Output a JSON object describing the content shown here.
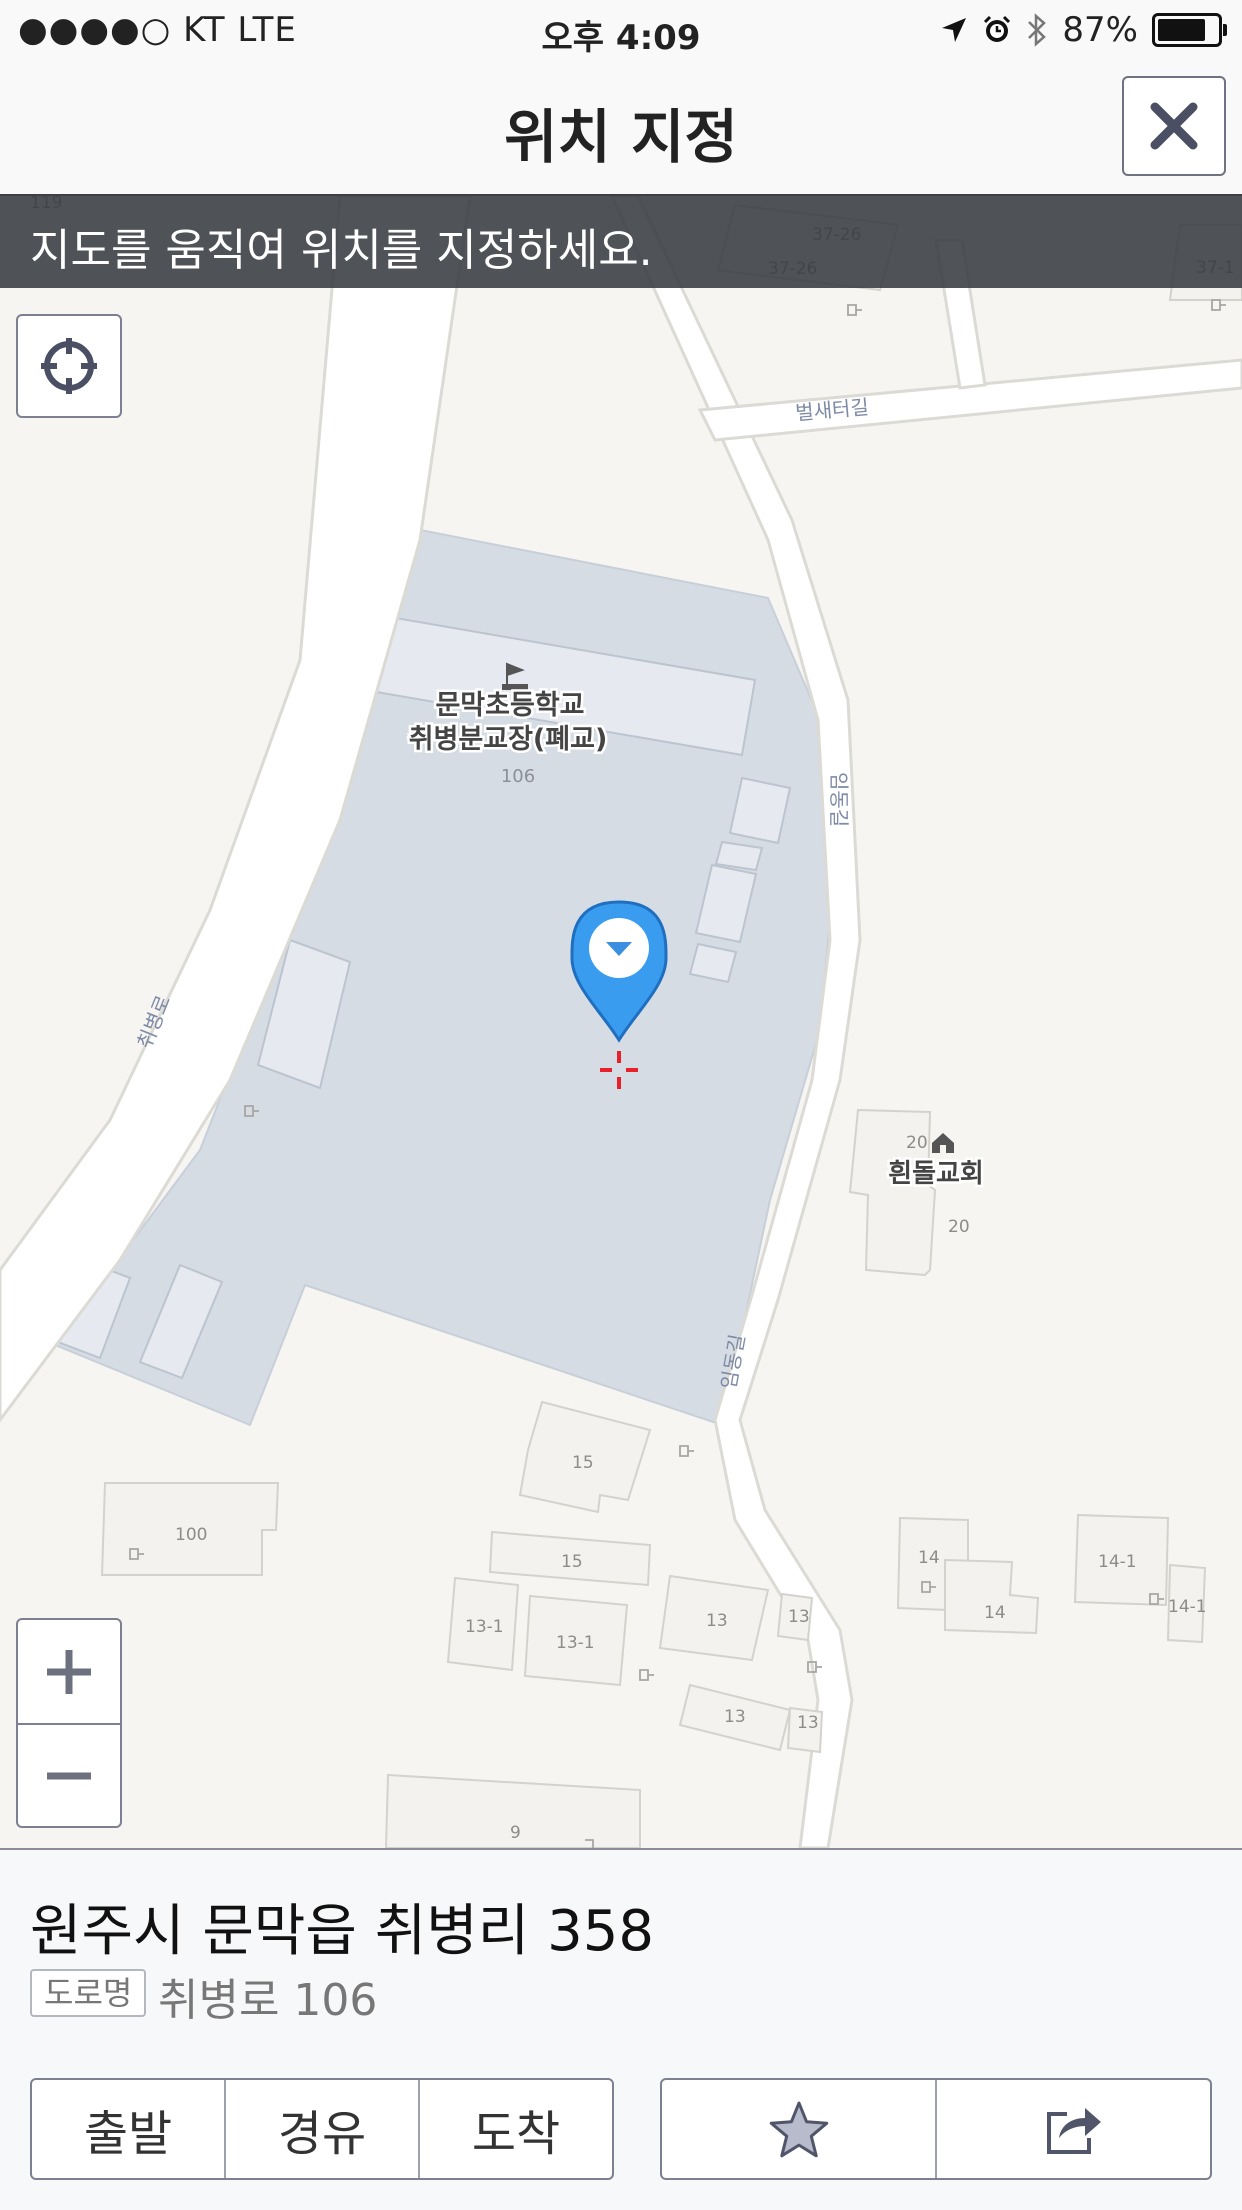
{
  "status_bar": {
    "carrier": "●●●●○ KT   LTE",
    "time": "오후 4:09",
    "battery": "87%",
    "battery_level": 0.87
  },
  "header": {
    "title": "위치 지정",
    "close_icon": "close-icon"
  },
  "banner": {
    "text": "지도를 움직여 위치를 지정하세요."
  },
  "map": {
    "school_name": "문막초등학교",
    "school_sub": "취병분교장(폐교)",
    "school_number": "106",
    "church_name": "흰돌교회",
    "roads": {
      "r1": "취병로",
      "r2": "벌새터길",
      "r3": "임동길",
      "r4": "임동길"
    },
    "lot_numbers": {
      "n1": "37-26",
      "n2": "37-26",
      "n3": "37-1",
      "n4": "119",
      "n5": "20",
      "n6": "20",
      "n7": "15",
      "n8": "15",
      "n9": "100",
      "n10": "13-1",
      "n11": "13-1",
      "n12": "13",
      "n13": "13",
      "n14": "13",
      "n15": "13",
      "n16": "14",
      "n17": "14",
      "n18": "14-1",
      "n19": "14-1",
      "n20": "9"
    }
  },
  "bottom": {
    "address": "원주시 문막읍 취병리 358",
    "road_badge": "도로명",
    "road_address": "취병로 106",
    "buttons": {
      "start": "출발",
      "via": "경유",
      "arrive": "도착"
    },
    "icons": {
      "favorite": "star-icon",
      "share": "share-icon"
    }
  }
}
